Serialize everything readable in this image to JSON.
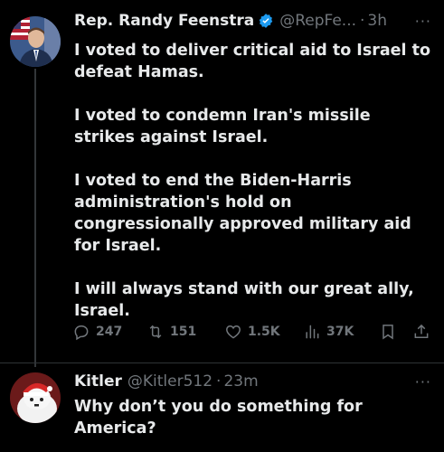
{
  "post": {
    "author_name": "Rep. Randy Feenstra",
    "handle": "@RepFe...",
    "time": "3h",
    "text": "I voted to deliver critical aid to Israel to defeat Hamas.\n\nI voted to condemn Iran's missile strikes against Israel.\n\nI voted to end the Biden-Harris administration's hold on congressionally approved military aid for Israel.\n\nI will always stand with our great ally, Israel.",
    "replies": "247",
    "reposts": "151",
    "likes": "1.5K",
    "views": "37K",
    "more": "···"
  },
  "reply": {
    "author_name": "Kitler",
    "handle": "@Kitler512",
    "time": "23m",
    "text": "Why don’t you do something for America?",
    "more": "···"
  },
  "colors": {
    "background": "#000000",
    "text": "#e7e9ea",
    "muted": "#71767b",
    "verified": "#1d9bf0"
  },
  "icons": [
    "verified-badge-icon",
    "reply-icon",
    "repost-icon",
    "like-icon",
    "views-icon",
    "bookmark-icon",
    "share-icon",
    "more-icon"
  ]
}
